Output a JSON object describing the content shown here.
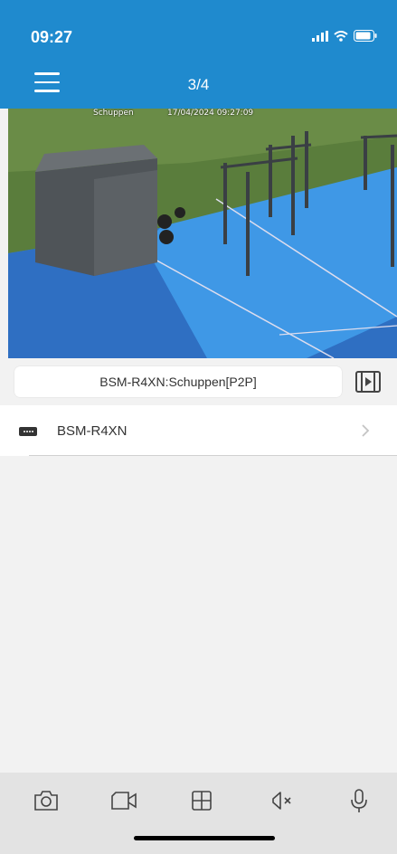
{
  "status_bar": {
    "time": "09:27"
  },
  "header": {
    "page_counter": "3/4"
  },
  "camera": {
    "osd_name": "Schuppen",
    "osd_timestamp": "17/04/2024 09:27:09"
  },
  "channel": {
    "name": "BSM-R4XN:Schuppen[P2P]"
  },
  "devices": [
    {
      "name": "BSM-R4XN"
    }
  ],
  "colors": {
    "header": "#1f8ace",
    "toolbar": "#e3e3e3",
    "background": "#f2f2f2"
  }
}
